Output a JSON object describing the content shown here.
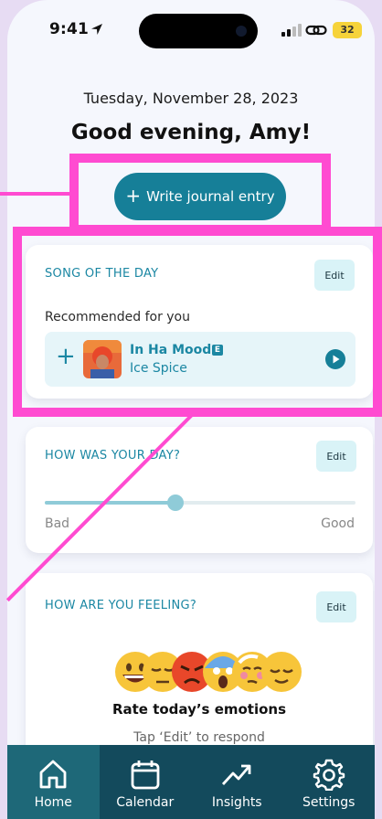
{
  "status_bar": {
    "time": "9:41",
    "battery": "32"
  },
  "header": {
    "date": "Tuesday, November 28, 2023",
    "greeting": "Good evening, Amy!"
  },
  "write_button": {
    "label": "Write journal entry"
  },
  "song_card": {
    "title": "SONG OF THE DAY",
    "edit_label": "Edit",
    "subtitle": "Recommended for you",
    "song": {
      "name": "In Ha Mood",
      "explicit_badge": "E",
      "artist": "Ice Spice"
    }
  },
  "day_card": {
    "title": "HOW WAS YOUR DAY?",
    "edit_label": "Edit",
    "min_label": "Bad",
    "max_label": "Good",
    "slider_value": 0.42
  },
  "feeling_card": {
    "title": "HOW ARE YOU FEELING?",
    "edit_label": "Edit",
    "emojis": [
      "grinning-face",
      "pensive-face",
      "pouting-face",
      "screaming-face",
      "woozy-face",
      "relieved-face"
    ],
    "rate_title": "Rate today’s emotions",
    "rate_subtitle": "Tap ‘Edit’ to respond"
  },
  "tabbar": {
    "active": "home",
    "items": [
      {
        "label": "Home",
        "icon": "home-icon"
      },
      {
        "label": "Calendar",
        "icon": "calendar-icon"
      },
      {
        "label": "Insights",
        "icon": "trending-up-icon"
      },
      {
        "label": "Settings",
        "icon": "gear-icon"
      }
    ]
  },
  "colors": {
    "accent": "#167f98",
    "annotation": "#ff4bd1",
    "tabbar": "#134a5c"
  }
}
